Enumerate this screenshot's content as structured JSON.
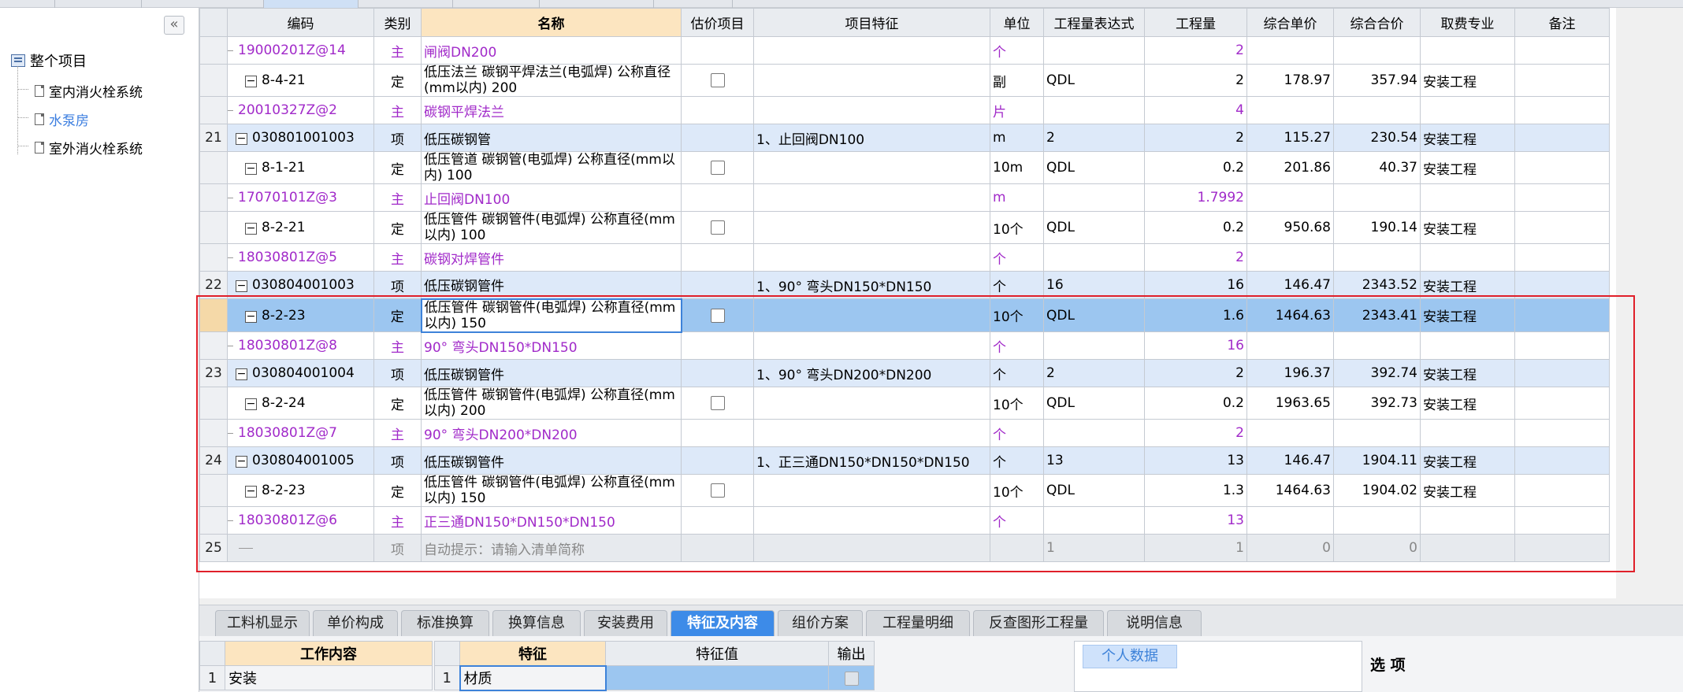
{
  "tree": {
    "root": "整个项目",
    "items": [
      "室内消火栓系统",
      "水泵房",
      "室外消火栓系统"
    ],
    "selected_index": 1
  },
  "grid": {
    "headers": [
      "编码",
      "类别",
      "名称",
      "估价项目",
      "项目特征",
      "单位",
      "工程量表达式",
      "工程量",
      "综合单价",
      "综合合价",
      "取费专业",
      "备注"
    ],
    "rows": [
      {
        "type": "mat",
        "rn": "",
        "code": "19000201Z@14",
        "cat": "主",
        "name": "闸阀DN200",
        "feature": "",
        "unit": "个",
        "expr": "",
        "qty": "2",
        "price": "",
        "total": "",
        "major": "",
        "note": ""
      },
      {
        "type": "quota",
        "rn": "",
        "code": "8-4-21",
        "cat": "定",
        "name": "低压法兰 碳钢平焊法兰(电弧焊) 公称直径(mm以内) 200",
        "feature": "",
        "unit": "副",
        "expr": "QDL",
        "qty": "2",
        "price": "178.97",
        "total": "357.94",
        "major": "安装工程",
        "note": ""
      },
      {
        "type": "mat",
        "rn": "",
        "code": "20010327Z@2",
        "cat": "主",
        "name": "碳钢平焊法兰",
        "feature": "",
        "unit": "片",
        "expr": "",
        "qty": "4",
        "price": "",
        "total": "",
        "major": "",
        "note": ""
      },
      {
        "type": "item",
        "rn": "21",
        "code": "030801001003",
        "cat": "项",
        "name": "低压碳钢管",
        "feature": "1、止回阀DN100",
        "unit": "m",
        "expr": "2",
        "qty": "2",
        "price": "115.27",
        "total": "230.54",
        "major": "安装工程",
        "note": ""
      },
      {
        "type": "quota",
        "rn": "",
        "code": "8-1-21",
        "cat": "定",
        "name": "低压管道 碳钢管(电弧焊) 公称直径(mm以内) 100",
        "feature": "",
        "unit": "10m",
        "expr": "QDL",
        "qty": "0.2",
        "price": "201.86",
        "total": "40.37",
        "major": "安装工程",
        "note": ""
      },
      {
        "type": "mat",
        "rn": "",
        "code": "17070101Z@3",
        "cat": "主",
        "name": "止回阀DN100",
        "feature": "",
        "unit": "m",
        "expr": "",
        "qty": "1.7992",
        "price": "",
        "total": "",
        "major": "",
        "note": ""
      },
      {
        "type": "quota",
        "rn": "",
        "code": "8-2-21",
        "cat": "定",
        "name": "低压管件 碳钢管件(电弧焊) 公称直径(mm以内) 100",
        "feature": "",
        "unit": "10个",
        "expr": "QDL",
        "qty": "0.2",
        "price": "950.68",
        "total": "190.14",
        "major": "安装工程",
        "note": ""
      },
      {
        "type": "mat",
        "rn": "",
        "code": "18030801Z@5",
        "cat": "主",
        "name": "碳钢对焊管件",
        "feature": "",
        "unit": "个",
        "expr": "",
        "qty": "2",
        "price": "",
        "total": "",
        "major": "",
        "note": ""
      },
      {
        "type": "item",
        "rn": "22",
        "code": "030804001003",
        "cat": "项",
        "name": "低压碳钢管件",
        "feature": "1、90° 弯头DN150*DN150",
        "unit": "个",
        "expr": "16",
        "qty": "16",
        "price": "146.47",
        "total": "2343.52",
        "major": "安装工程",
        "note": ""
      },
      {
        "type": "cur",
        "rn": "",
        "code": "8-2-23",
        "cat": "定",
        "name": "低压管件 碳钢管件(电弧焊) 公称直径(mm以内) 150",
        "feature": "",
        "unit": "10个",
        "expr": "QDL",
        "qty": "1.6",
        "price": "1464.63",
        "total": "2343.41",
        "major": "安装工程",
        "note": ""
      },
      {
        "type": "mat",
        "rn": "",
        "code": "18030801Z@8",
        "cat": "主",
        "name": "90° 弯头DN150*DN150",
        "feature": "",
        "unit": "个",
        "expr": "",
        "qty": "16",
        "price": "",
        "total": "",
        "major": "",
        "note": ""
      },
      {
        "type": "item",
        "rn": "23",
        "code": "030804001004",
        "cat": "项",
        "name": "低压碳钢管件",
        "feature": "1、90° 弯头DN200*DN200",
        "unit": "个",
        "expr": "2",
        "qty": "2",
        "price": "196.37",
        "total": "392.74",
        "major": "安装工程",
        "note": ""
      },
      {
        "type": "quota",
        "rn": "",
        "code": "8-2-24",
        "cat": "定",
        "name": "低压管件 碳钢管件(电弧焊) 公称直径(mm以内) 200",
        "feature": "",
        "unit": "10个",
        "expr": "QDL",
        "qty": "0.2",
        "price": "1963.65",
        "total": "392.73",
        "major": "安装工程",
        "note": ""
      },
      {
        "type": "mat",
        "rn": "",
        "code": "18030801Z@7",
        "cat": "主",
        "name": "90° 弯头DN200*DN200",
        "feature": "",
        "unit": "个",
        "expr": "",
        "qty": "2",
        "price": "",
        "total": "",
        "major": "",
        "note": ""
      },
      {
        "type": "item",
        "rn": "24",
        "code": "030804001005",
        "cat": "项",
        "name": "低压碳钢管件",
        "feature": "1、正三通DN150*DN150*DN150",
        "unit": "个",
        "expr": "13",
        "qty": "13",
        "price": "146.47",
        "total": "1904.11",
        "major": "安装工程",
        "note": ""
      },
      {
        "type": "quota",
        "rn": "",
        "code": "8-2-23",
        "cat": "定",
        "name": "低压管件 碳钢管件(电弧焊) 公称直径(mm以内) 150",
        "feature": "",
        "unit": "10个",
        "expr": "QDL",
        "qty": "1.3",
        "price": "1464.63",
        "total": "1904.02",
        "major": "安装工程",
        "note": ""
      },
      {
        "type": "mat",
        "rn": "",
        "code": "18030801Z@6",
        "cat": "主",
        "name": "正三通DN150*DN150*DN150",
        "feature": "",
        "unit": "个",
        "expr": "",
        "qty": "13",
        "price": "",
        "total": "",
        "major": "",
        "note": ""
      },
      {
        "type": "auto",
        "rn": "25",
        "code": "",
        "cat": "项",
        "name": "自动提示：请输入清单简称",
        "feature": "",
        "unit": "",
        "expr": "1",
        "qty": "1",
        "price": "0",
        "total": "0",
        "major": "",
        "note": ""
      }
    ]
  },
  "tabs": {
    "items": [
      "工料机显示",
      "单价构成",
      "标准换算",
      "换算信息",
      "安装费用",
      "特征及内容",
      "组价方案",
      "工程量明细",
      "反查图形工程量",
      "说明信息"
    ],
    "active_index": 5
  },
  "bottom": {
    "work_header": "工作内容",
    "work_rows": [
      {
        "n": "1",
        "text": "安装"
      }
    ],
    "feature_header": "特征",
    "feature_value_header": "特征值",
    "output_header": "输出",
    "feature_rows": [
      {
        "n": "1",
        "text": "材质"
      }
    ],
    "personal_button": "个人数据",
    "options_title": "选 项"
  },
  "colors": {
    "accent": "#3d8be8",
    "material_text": "#a12ac9",
    "highlight_box": "#e0202a",
    "item_row": "#dde9f9",
    "current_row": "#9cc6f0"
  }
}
